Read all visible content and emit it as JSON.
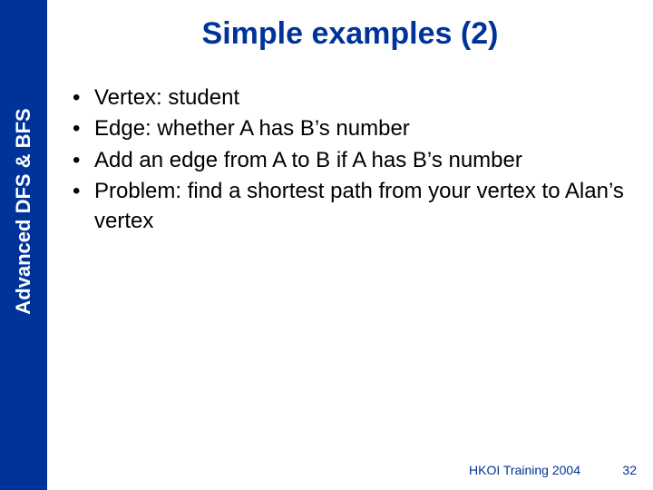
{
  "sidebar": {
    "label": "Advanced DFS & BFS"
  },
  "title": "Simple examples (2)",
  "bullets": [
    "Vertex: student",
    "Edge: whether A has B’s number",
    "Add an edge from A to B if A has B’s number",
    "Problem: find a shortest path from your vertex to Alan’s vertex"
  ],
  "footer": {
    "text": "HKOI Training 2004",
    "page": "32"
  }
}
